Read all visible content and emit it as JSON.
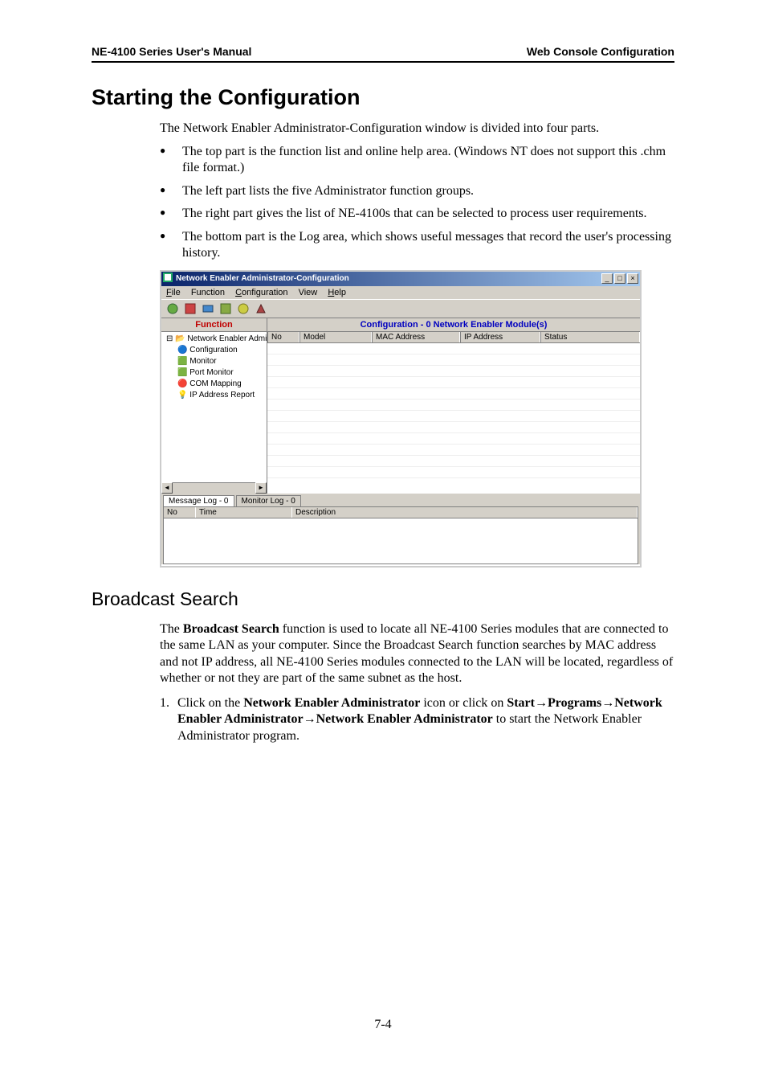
{
  "header": {
    "left": "NE-4100 Series User's Manual",
    "right": "Web Console Configuration"
  },
  "h1": "Starting the Configuration",
  "intro": "The Network Enabler Administrator-Configuration window is divided into four parts.",
  "bullets": [
    "The top part is the function list and online help area. (Windows NT does not support this .chm file format.)",
    "The left part lists the five Administrator function groups.",
    "The right part gives the list of NE-4100s that can be selected to process user requirements.",
    "The bottom part is the Log area, which shows useful messages that record the user's processing history."
  ],
  "screenshot": {
    "title": "Network Enabler Administrator-Configuration",
    "menus": {
      "file": "File",
      "function": "Function",
      "configuration": "Configuration",
      "view": "View",
      "help": "Help"
    },
    "function_header": "Function",
    "config_header": "Configuration - 0 Network Enabler Module(s)",
    "tree": {
      "root": "Network Enabler Admin",
      "items": [
        "Configuration",
        "Monitor",
        "Port Monitor",
        "COM Mapping",
        "IP Address Report"
      ]
    },
    "grid_cols": {
      "no": "No",
      "model": "Model",
      "mac": "MAC Address",
      "ip": "IP Address",
      "status": "Status"
    },
    "log_tabs": {
      "msg": "Message Log - 0",
      "mon": "Monitor Log - 0"
    },
    "log_cols": {
      "no": "No",
      "time": "Time",
      "desc": "Description"
    },
    "winbtns": {
      "min": "_",
      "max": "□",
      "close": "×"
    }
  },
  "h2": "Broadcast Search",
  "bs_para_pre": "The ",
  "bs_bold1": "Broadcast Search",
  "bs_para_post": " function is used to locate all NE-4100 Series modules that are connected to the same LAN as your computer. Since the Broadcast Search function searches by MAC address and not IP address, all NE-4100 Series modules connected to the LAN will be located, regardless of whether or not they are part of the same subnet as the host.",
  "step1": {
    "num": "1.",
    "t1": "Click on the ",
    "b1": "Network Enabler Administrator",
    "t2": " icon or click on ",
    "b2": "Start",
    "arrow": "→",
    "b3": "Programs",
    "b4": "Network Enabler Administrator",
    "b5": "Network Enabler Administrator",
    "t3": " to start the Network Enabler Administrator program."
  },
  "footer": "7-4"
}
